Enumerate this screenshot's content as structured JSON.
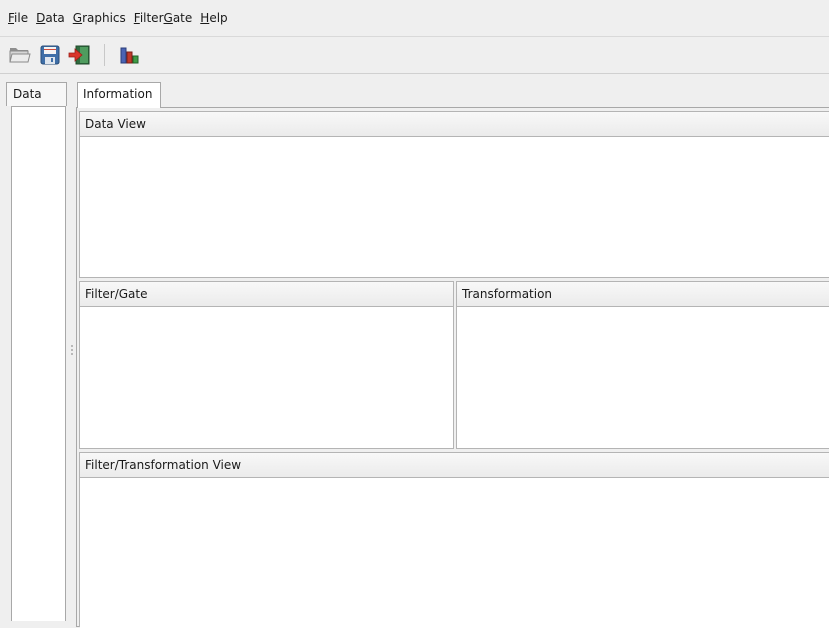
{
  "menu": {
    "items": [
      {
        "mnemonic": "F",
        "rest": "ile"
      },
      {
        "mnemonic": "D",
        "rest": "ata",
        "pre": ""
      },
      {
        "mnemonic": "G",
        "rest": "raphics",
        "pre": ""
      },
      {
        "pre": "Filter",
        "mnemonic": "G",
        "rest": "ate",
        "pre_mn": "F"
      },
      {
        "mnemonic": "H",
        "rest": "elp",
        "pre": ""
      }
    ],
    "file": {
      "mn": "F",
      "rest": "ile"
    },
    "data": {
      "mn": "D",
      "rest": "ata"
    },
    "graphics": {
      "mn": "G",
      "rest": "raphics"
    },
    "filtergate": {
      "mn1": "F",
      "mid": "ilter",
      "mn2": "G",
      "rest": "ate"
    },
    "help": {
      "mn": "H",
      "rest": "elp"
    }
  },
  "toolbar": {
    "icons": [
      "open-folder-icon",
      "save-icon",
      "exit-icon",
      "chart-icon"
    ]
  },
  "left": {
    "tab_label": "Data"
  },
  "main": {
    "tab_label": "Information",
    "data_view": "Data View",
    "filter_gate": "Filter/Gate",
    "transformation": "Transformation",
    "filter_transformation_view": "Filter/Transformation View"
  }
}
